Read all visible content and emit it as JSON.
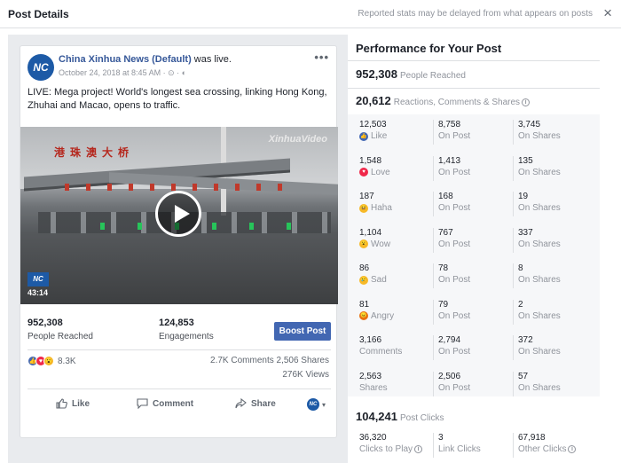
{
  "header": {
    "title": "Post Details",
    "note": "Reported stats may be delayed from what appears on posts",
    "close_icon": "×"
  },
  "post": {
    "avatar_text": "NC",
    "page_name": "China Xinhua News (Default)",
    "page_suffix": " was live.",
    "timestamp": "October 24, 2018 at 8:45 AM · ⊙ · ◐",
    "more_label": "•••",
    "text": "LIVE: Mega project! World's longest sea crossing, linking Hong Kong, Zhuhai and Macao, opens to traffic.",
    "video": {
      "watermark": "XinhuaVideo",
      "sign_text": "港珠澳大桥",
      "logo_text": "NC",
      "duration": "43:14"
    },
    "people_reached": {
      "value": "952,308",
      "label": "People Reached"
    },
    "engagements": {
      "value": "124,853",
      "label": "Engagements"
    },
    "boost_label": "Boost Post",
    "reaction_count": "8.3K",
    "comments_shares": "2.7K Comments  2,506 Shares",
    "views": "276K Views",
    "actions": {
      "like": "Like",
      "comment": "Comment",
      "share": "Share",
      "page_avatar": "NC",
      "caret": "▾"
    }
  },
  "performance": {
    "title": "Performance for Your Post",
    "reached": {
      "value": "952,308",
      "label": "People Reached"
    },
    "reactions_total": {
      "value": "20,612",
      "label": "Reactions, Comments & Shares",
      "info": "i"
    },
    "rows": [
      {
        "emoji": "like",
        "emoji_color": "#4267b2",
        "glyph": "👍",
        "total": "12,503",
        "label": "Like",
        "on_post": "8,758",
        "on_post_label": "On Post",
        "on_shares": "3,745",
        "on_shares_label": "On Shares"
      },
      {
        "emoji": "love",
        "emoji_color": "#f0284a",
        "glyph": "♥",
        "total": "1,548",
        "label": "Love",
        "on_post": "1,413",
        "on_post_label": "On Post",
        "on_shares": "135",
        "on_shares_label": "On Shares"
      },
      {
        "emoji": "haha",
        "emoji_color": "#f7b928",
        "glyph": "😆",
        "total": "187",
        "label": "Haha",
        "on_post": "168",
        "on_post_label": "On Post",
        "on_shares": "19",
        "on_shares_label": "On Shares"
      },
      {
        "emoji": "wow",
        "emoji_color": "#f7b928",
        "glyph": "😮",
        "total": "1,104",
        "label": "Wow",
        "on_post": "767",
        "on_post_label": "On Post",
        "on_shares": "337",
        "on_shares_label": "On Shares"
      },
      {
        "emoji": "sad",
        "emoji_color": "#f7b928",
        "glyph": "😢",
        "total": "86",
        "label": "Sad",
        "on_post": "78",
        "on_post_label": "On Post",
        "on_shares": "8",
        "on_shares_label": "On Shares"
      },
      {
        "emoji": "angry",
        "emoji_color": "#e9710f",
        "glyph": "😠",
        "total": "81",
        "label": "Angry",
        "on_post": "79",
        "on_post_label": "On Post",
        "on_shares": "2",
        "on_shares_label": "On Shares"
      },
      {
        "emoji": "",
        "emoji_color": "",
        "glyph": "",
        "total": "3,166",
        "label": "Comments",
        "on_post": "2,794",
        "on_post_label": "On Post",
        "on_shares": "372",
        "on_shares_label": "On Shares"
      },
      {
        "emoji": "",
        "emoji_color": "",
        "glyph": "",
        "total": "2,563",
        "label": "Shares",
        "on_post": "2,506",
        "on_post_label": "On Post",
        "on_shares": "57",
        "on_shares_label": "On Shares"
      }
    ],
    "post_clicks": {
      "value": "104,241",
      "label": "Post Clicks"
    },
    "clicks": [
      {
        "value": "36,320",
        "label": "Clicks to Play",
        "info": "i"
      },
      {
        "value": "3",
        "label": "Link Clicks",
        "info": ""
      },
      {
        "value": "67,918",
        "label": "Other Clicks",
        "info": "i"
      }
    ]
  }
}
